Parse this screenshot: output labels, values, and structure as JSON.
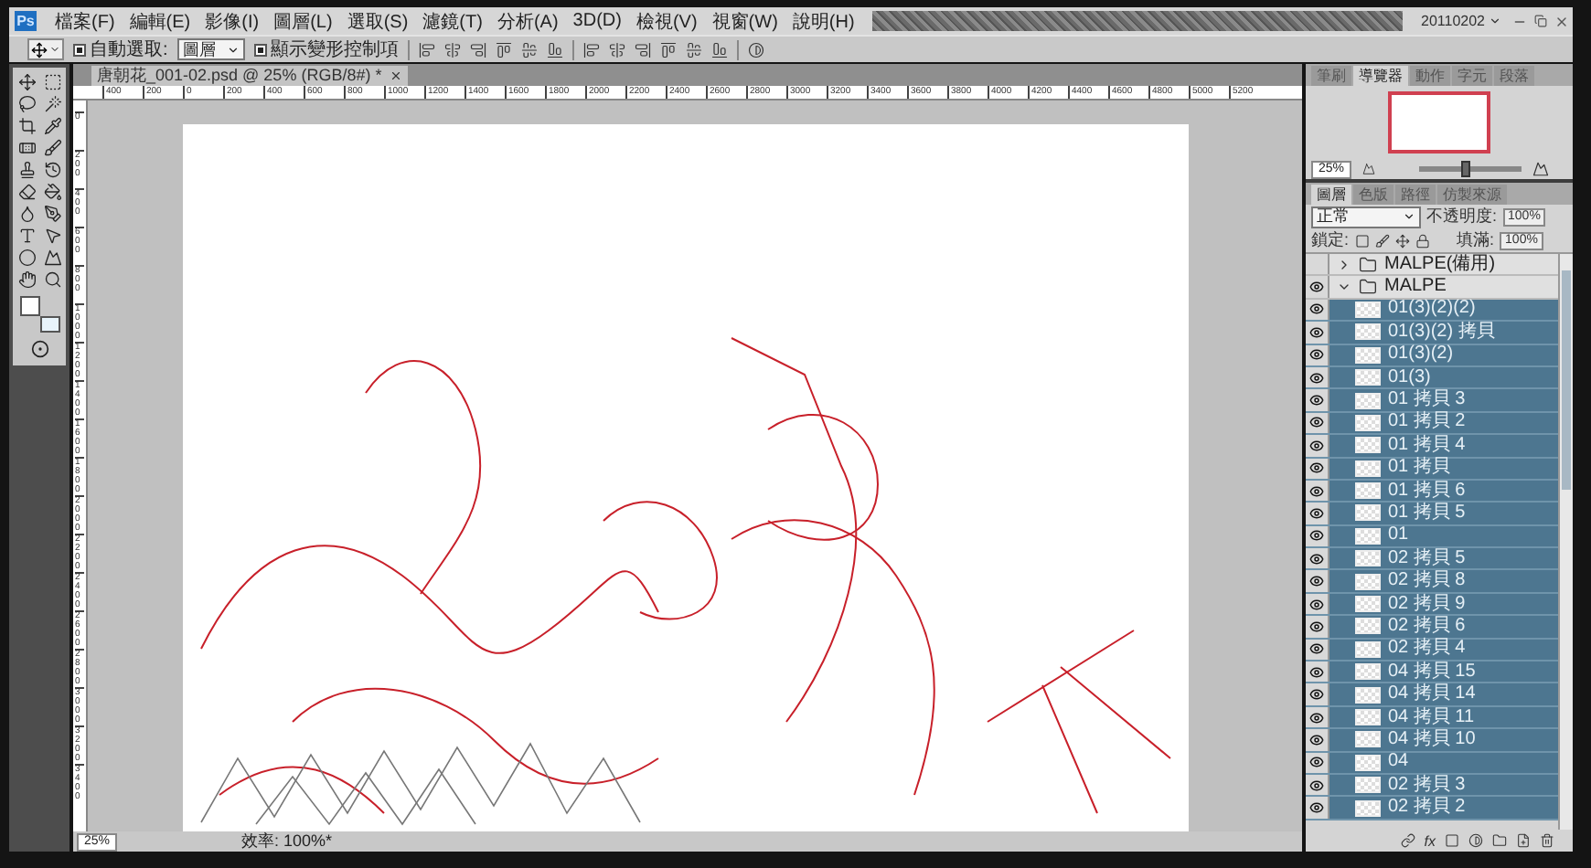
{
  "app_logo": "Ps",
  "menu": [
    "檔案(F)",
    "編輯(E)",
    "影像(I)",
    "圖層(L)",
    "選取(S)",
    "濾鏡(T)",
    "分析(A)",
    "3D(D)",
    "檢視(V)",
    "視窗(W)",
    "說明(H)"
  ],
  "workspace": "20110202",
  "options_bar": {
    "auto_select": {
      "label": "自動選取:",
      "checked": true
    },
    "auto_select_target": "圖層",
    "transform_controls": {
      "label": "顯示變形控制項",
      "checked": true
    }
  },
  "document": {
    "tab_title": "唐朝花_001-02.psd @ 25% (RGB/8#) *",
    "ruler_h": [
      "400",
      "200",
      "0",
      "200",
      "400",
      "600",
      "800",
      "1000",
      "1200",
      "1400",
      "1600",
      "1800",
      "2000",
      "2200",
      "2400",
      "2600",
      "2800",
      "3000",
      "3200",
      "3400",
      "3600",
      "3800",
      "4000",
      "4200",
      "4400",
      "4600",
      "4800",
      "5000",
      "5200"
    ],
    "ruler_v": [
      "0",
      "200",
      "400",
      "600",
      "800",
      "1000",
      "1200",
      "1400",
      "1600",
      "1800",
      "2000",
      "2200",
      "2400",
      "2600",
      "2800",
      "3000",
      "3200",
      "3400"
    ],
    "zoom": "25%",
    "status": "效率: 100%*"
  },
  "navigator": {
    "tabs": [
      {
        "label": "筆刷",
        "selected": false
      },
      {
        "label": "導覽器",
        "selected": true
      },
      {
        "label": "動作",
        "selected": false
      },
      {
        "label": "字元",
        "selected": false
      },
      {
        "label": "段落",
        "selected": false
      }
    ],
    "zoom": "25%",
    "level": 0.45
  },
  "layers_panel": {
    "tabs": [
      {
        "label": "圖層",
        "selected": true
      },
      {
        "label": "色版",
        "selected": false
      },
      {
        "label": "路徑",
        "selected": false
      },
      {
        "label": "仿製來源",
        "selected": false
      }
    ],
    "blend_mode": "正常",
    "opacity_label": "不透明度:",
    "opacity": "100%",
    "lock_label": "鎖定:",
    "fill_label": "填滿:",
    "fill": "100%",
    "fx_label": "fx",
    "layers": [
      {
        "kind": "group",
        "name": "MALPE(備用)",
        "visible": false,
        "selected": false,
        "expanded": false
      },
      {
        "kind": "group",
        "name": "MALPE",
        "visible": true,
        "selected": false,
        "expanded": true,
        "children": [
          {
            "kind": "layer",
            "name": "01(3)(2)(2)",
            "visible": true,
            "selected": true
          },
          {
            "kind": "layer",
            "name": "01(3)(2) 拷貝",
            "visible": true,
            "selected": true
          },
          {
            "kind": "layer",
            "name": "01(3)(2)",
            "visible": true,
            "selected": true
          },
          {
            "kind": "layer",
            "name": "01(3)",
            "visible": true,
            "selected": true
          },
          {
            "kind": "layer",
            "name": "01 拷貝 3",
            "visible": true,
            "selected": true
          },
          {
            "kind": "layer",
            "name": "01 拷貝 2",
            "visible": true,
            "selected": true
          },
          {
            "kind": "layer",
            "name": "01 拷貝 4",
            "visible": true,
            "selected": true
          },
          {
            "kind": "layer",
            "name": "01 拷貝",
            "visible": true,
            "selected": true
          },
          {
            "kind": "layer",
            "name": "01 拷貝 6",
            "visible": true,
            "selected": true
          },
          {
            "kind": "layer",
            "name": "01 拷貝 5",
            "visible": true,
            "selected": true
          },
          {
            "kind": "layer",
            "name": "01",
            "visible": true,
            "selected": true
          },
          {
            "kind": "layer",
            "name": "02 拷貝 5",
            "visible": true,
            "selected": true
          },
          {
            "kind": "layer",
            "name": "02 拷貝 8",
            "visible": true,
            "selected": true
          },
          {
            "kind": "layer",
            "name": "02 拷貝 9",
            "visible": true,
            "selected": true
          },
          {
            "kind": "layer",
            "name": "02 拷貝 6",
            "visible": true,
            "selected": true
          },
          {
            "kind": "layer",
            "name": "02 拷貝 4",
            "visible": true,
            "selected": true
          },
          {
            "kind": "layer",
            "name": "04 拷貝 15",
            "visible": true,
            "selected": true
          },
          {
            "kind": "layer",
            "name": "04 拷貝 14",
            "visible": true,
            "selected": true
          },
          {
            "kind": "layer",
            "name": "04 拷貝 11",
            "visible": true,
            "selected": true
          },
          {
            "kind": "layer",
            "name": "04 拷貝 10",
            "visible": true,
            "selected": true
          },
          {
            "kind": "layer",
            "name": "04",
            "visible": true,
            "selected": true
          },
          {
            "kind": "layer",
            "name": "02 拷貝 3",
            "visible": true,
            "selected": true
          },
          {
            "kind": "layer",
            "name": "02 拷貝 2",
            "visible": true,
            "selected": true
          }
        ]
      }
    ]
  }
}
